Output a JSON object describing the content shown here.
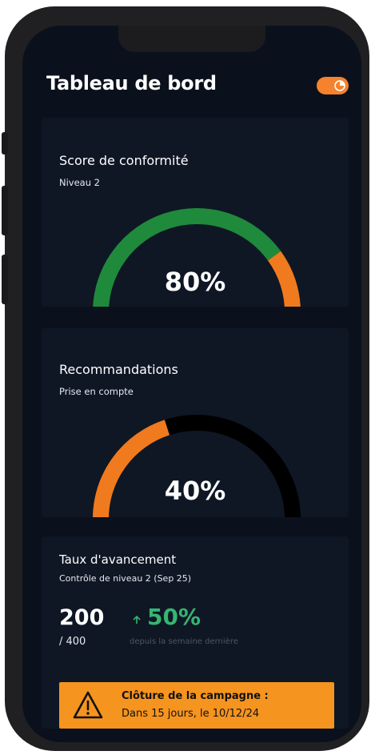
{
  "header": {
    "title": "Tableau de bord"
  },
  "theme_toggle": {
    "icon": "moon-icon",
    "color": "#f5822c"
  },
  "compliance": {
    "title": "Score de conformité",
    "subtitle": "Niveau 2",
    "value_label": "80%",
    "value": 0.8,
    "colors": {
      "filled": "#1f8a3b",
      "remaining": "#f07a1e"
    }
  },
  "recommendations": {
    "title": "Recommandations",
    "subtitle": "Prise en compte",
    "value_label": "40%",
    "value": 0.4,
    "colors": {
      "filled": "#f07a1e",
      "remaining": "#000000"
    }
  },
  "progress": {
    "title": "Taux d'avancement",
    "subtitle": "Contrôle de niveau 2 (Sep 25)",
    "count": "200",
    "total": "/ 400",
    "trend_icon": "arrow-up-icon",
    "trend_value": "50%",
    "trend_note": "depuis la semaine dernière",
    "trend_color": "#35b571"
  },
  "alert": {
    "icon": "warning-icon",
    "title": "Clôture de la campagne :",
    "text": "Dans 15 jours, le 10/12/24",
    "color": "#f5941f"
  }
}
